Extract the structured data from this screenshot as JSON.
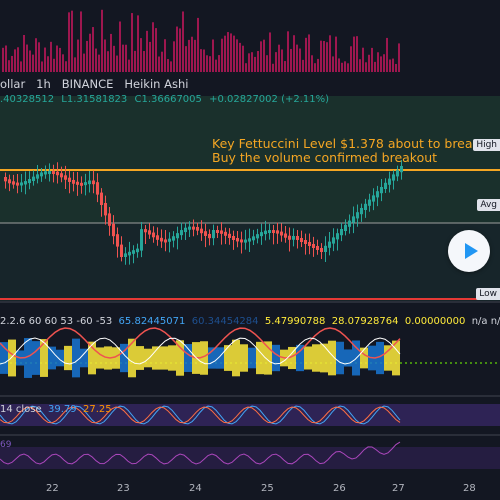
{
  "header": {
    "symbol": "ollar",
    "interval": "1h",
    "exchange": "BINANCE",
    "chart_style": "Heikin Ashi",
    "ohlc_open": ".40328512",
    "ohlc_low": "L1.31581823",
    "ohlc_close": "C1.36667005",
    "ohlc_change": "+0.02827002 (+2.11%)"
  },
  "annotation": {
    "line1": "Key Fettuccini Level $1.378 about to brea",
    "line2": "Buy the volume confirmed breakout"
  },
  "price_tags": {
    "high": "High",
    "avg": "Avg",
    "low": "Low"
  },
  "indicator1": {
    "params": "2.2.6 60 60 53 -60 -53",
    "v1": "65.82445071",
    "v2": "60.34454284",
    "v3": "5.47990788",
    "v4": "28.07928764",
    "v5": "0.00000000",
    "na1": "n/a",
    "na2": "n/a"
  },
  "indicator2": {
    "label": "14 close",
    "v1": "39.79",
    "v2": "27.25"
  },
  "indicator3": {
    "label": "69"
  },
  "x_axis": {
    "labels": [
      "22",
      "23",
      "24",
      "25",
      "26",
      "27",
      "28"
    ]
  },
  "colors": {
    "up": "#26a69a",
    "down": "#ef5350",
    "annotation": "#f5a623",
    "level": "#f5a623",
    "zone": "#1e3a2e",
    "volume": "#c2185b",
    "rsi_band": "#3a2a6b"
  },
  "controls": {
    "play_icon": "play-icon"
  }
}
